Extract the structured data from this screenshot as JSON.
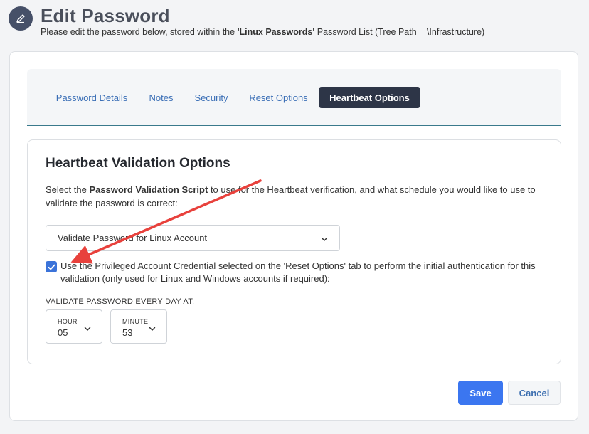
{
  "header": {
    "icon": "pencil-icon",
    "title": "Edit Password",
    "subtitle_prefix": "Please edit the password below, stored within the ",
    "subtitle_bold": "'Linux Passwords'",
    "subtitle_suffix": " Password List (Tree Path = \\Infrastructure)"
  },
  "tabs": [
    {
      "label": "Password Details",
      "active": false
    },
    {
      "label": "Notes",
      "active": false
    },
    {
      "label": "Security",
      "active": false
    },
    {
      "label": "Reset Options",
      "active": false
    },
    {
      "label": "Heartbeat Options",
      "active": true
    }
  ],
  "heartbeat": {
    "title": "Heartbeat Validation Options",
    "desc_prefix": "Select the ",
    "desc_bold": "Password Validation Script",
    "desc_suffix": " to use for the Heartbeat verification, and what schedule you would like to use to validate the password is correct:",
    "script_select": {
      "value": "Validate Password for Linux Account"
    },
    "use_privileged": {
      "checked": true,
      "label": "Use the Privileged Account Credential selected on the 'Reset Options' tab to perform the initial authentication for this validation (only used for Linux and Windows accounts if required):"
    },
    "schedule_label": "VALIDATE PASSWORD EVERY DAY AT:",
    "hour": {
      "caption": "HOUR",
      "value": "05"
    },
    "minute": {
      "caption": "MINUTE",
      "value": "53"
    }
  },
  "actions": {
    "save_label": "Save",
    "cancel_label": "Cancel"
  },
  "colors": {
    "accent": "#3b76f0",
    "tab_active_bg": "#2d3547",
    "annotation_arrow": "#e8413c"
  }
}
